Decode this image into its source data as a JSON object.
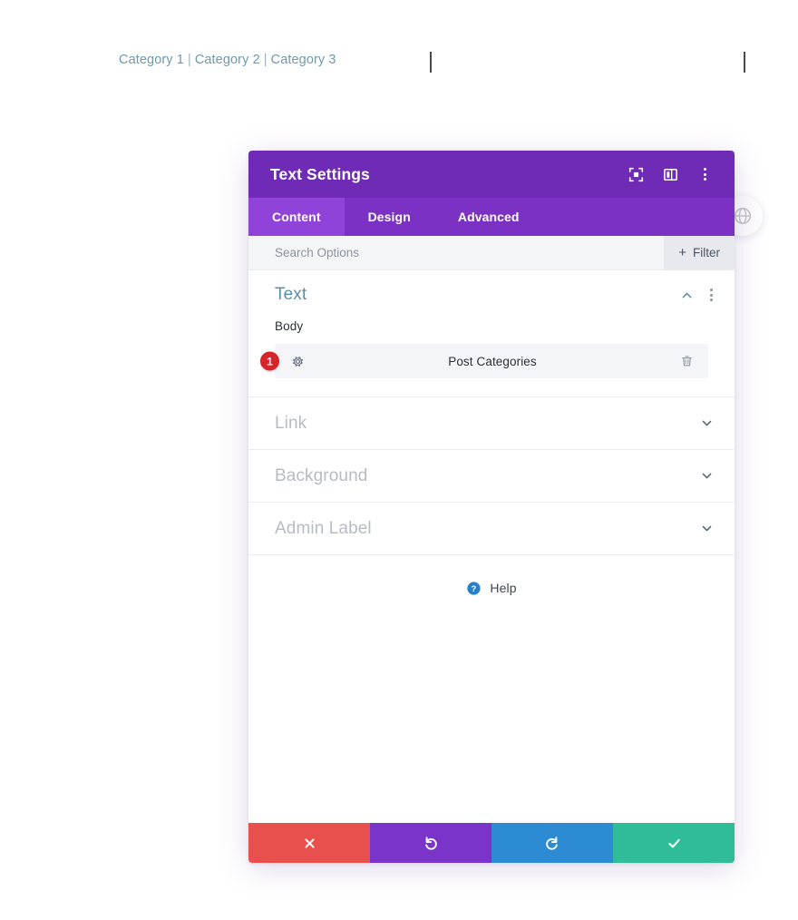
{
  "page": {
    "categories": [
      {
        "label": "Category 1"
      },
      {
        "label": "Category 2"
      },
      {
        "label": "Category 3"
      }
    ],
    "category_separator": "|",
    "link_color": "#6f99ac"
  },
  "modal": {
    "title": "Text Settings",
    "header_color": "#6f2bb5",
    "header_icons": [
      {
        "name": "focus-expand-icon"
      },
      {
        "name": "panel-layout-icon"
      },
      {
        "name": "more-options-icon"
      }
    ],
    "tabs": [
      {
        "label": "Content",
        "active": true
      },
      {
        "label": "Design",
        "active": false
      },
      {
        "label": "Advanced",
        "active": false
      }
    ],
    "search": {
      "placeholder": "Search Options",
      "value": ""
    },
    "filter": {
      "label": "Filter",
      "plus": "+"
    },
    "sections": [
      {
        "title": "Text",
        "expanded": true,
        "title_color": "#5b8fa8",
        "field": {
          "label": "Body",
          "dynamic_value": "Post Categories",
          "badge_count": "1",
          "badge_color": "#d8232a"
        }
      },
      {
        "title": "Link",
        "expanded": false
      },
      {
        "title": "Background",
        "expanded": false
      },
      {
        "title": "Admin Label",
        "expanded": false
      }
    ],
    "help": {
      "label": "Help"
    },
    "footer_buttons": [
      {
        "name": "cancel-button",
        "icon": "close-icon",
        "color": "#e8504d"
      },
      {
        "name": "undo-button",
        "icon": "undo-icon",
        "color": "#7a34c9"
      },
      {
        "name": "redo-button",
        "icon": "redo-icon",
        "color": "#2d8bd4"
      },
      {
        "name": "save-button",
        "icon": "check-icon",
        "color": "#2fbd97"
      }
    ]
  }
}
